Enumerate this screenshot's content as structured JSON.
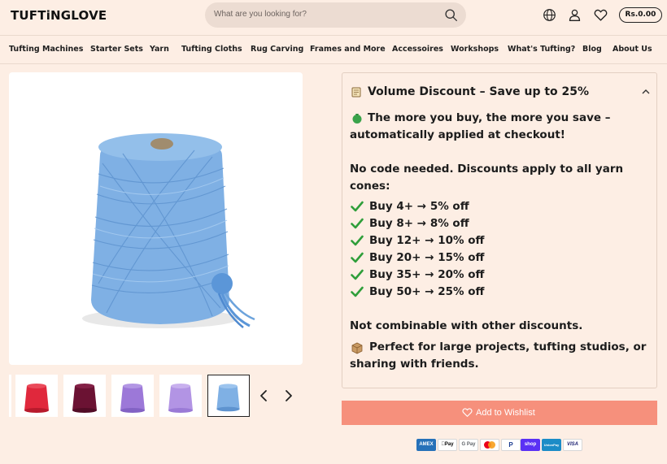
{
  "header": {
    "logo": "TUFTiNGLOVE",
    "search_placeholder": "What are you looking for?",
    "cart_total": "Rs.0.00",
    "icons": [
      "globe-icon",
      "user-icon",
      "heart-icon",
      "search-icon"
    ]
  },
  "nav": {
    "items": [
      "Tufting Machines",
      "Starter Sets",
      "Yarn",
      "Tufting Cloths",
      "Rug Carving",
      "Frames and More",
      "Accessoires",
      "Workshops",
      "What's Tufting?",
      "Blog",
      "About Us"
    ]
  },
  "product": {
    "main_color": "#7fb0e4",
    "thumbnails": [
      {
        "color": "#e0283c"
      },
      {
        "color": "#6b1233"
      },
      {
        "color": "#9c78d8"
      },
      {
        "color": "#b294e4"
      },
      {
        "color": "#7fb0e4",
        "active": true
      }
    ]
  },
  "discount": {
    "title": "Volume Discount – Save up to 25%",
    "intro_line1": "The more you buy, the more you save –",
    "intro_line2": "automatically applied at checkout!",
    "no_code_line1": "No code needed. Discounts apply to all yarn",
    "no_code_line2": "cones:",
    "tiers": [
      "Buy 4+ → 5% off",
      "Buy 8+ → 8% off",
      "Buy 12+ → 10% off",
      "Buy 20+ → 15% off",
      "Buy 35+ → 20% off",
      "Buy 50+ → 25% off"
    ],
    "not_combinable": "Not combinable with other discounts.",
    "perfect_line1": "Perfect for large projects, tufting studios, or",
    "perfect_line2": "sharing with friends."
  },
  "wishlist": {
    "label": "Add to Wishlist",
    "color": "#f6907c"
  },
  "payments": [
    {
      "label": "AMEX",
      "bg": "#2671b9",
      "fg": "#ffffff"
    },
    {
      "label": "Pay",
      "bg": "#ffffff",
      "fg": "#000000"
    },
    {
      "label": "G Pay",
      "bg": "#ffffff",
      "fg": "#5f6368"
    },
    {
      "label": "",
      "bg": "#ffffff",
      "fg": "#000000"
    },
    {
      "label": "P",
      "bg": "#ffffff",
      "fg": "#1a3b8f"
    },
    {
      "label": "shop",
      "bg": "#5a31f4",
      "fg": "#ffffff"
    },
    {
      "label": "UnionPay",
      "bg": "#1b8cc7",
      "fg": "#ffffff"
    },
    {
      "label": "VISA",
      "bg": "#ffffff",
      "fg": "#1a1f71"
    }
  ]
}
